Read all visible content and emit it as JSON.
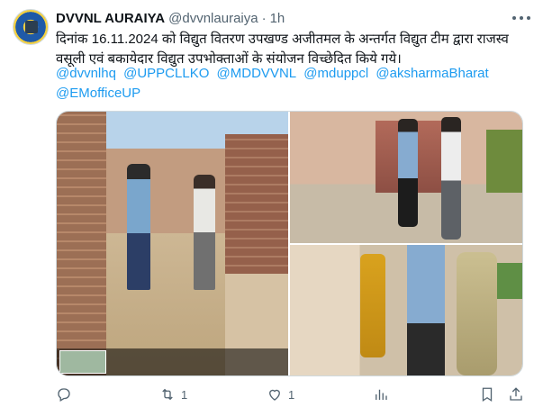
{
  "tweet": {
    "author_name": "DVVNL AURAIYA",
    "handle": "@dvvnlauraiya",
    "separator": "·",
    "time": "1h",
    "text": "दिनांक 16.11.2024 को विद्युत वितरण उपखण्ड अजीतमल के अन्तर्गत विद्युत टीम द्वारा राजस्व वसूली एवं बकायेदार विद्युत उपभोक्ताओं के संयोजन विच्छेदित किये गये।",
    "mentions": [
      "@dvvnlhq",
      "@UPPCLLKO",
      "@MDDVVNL",
      "@mduppcl",
      "@aksharmaBharat",
      "@EMofficeUP"
    ]
  },
  "actions": {
    "reply_count": "",
    "retweet_count": "1",
    "like_count": "1",
    "views_count": ""
  },
  "icons": {
    "avatar": "dvvnl-logo",
    "more": "more-icon",
    "reply": "reply-icon",
    "retweet": "retweet-icon",
    "like": "heart-icon",
    "views": "views-icon",
    "bookmark": "bookmark-icon",
    "share": "share-icon"
  },
  "colors": {
    "link": "#1d9bf0",
    "secondary": "#536471",
    "text": "#0f1419"
  }
}
